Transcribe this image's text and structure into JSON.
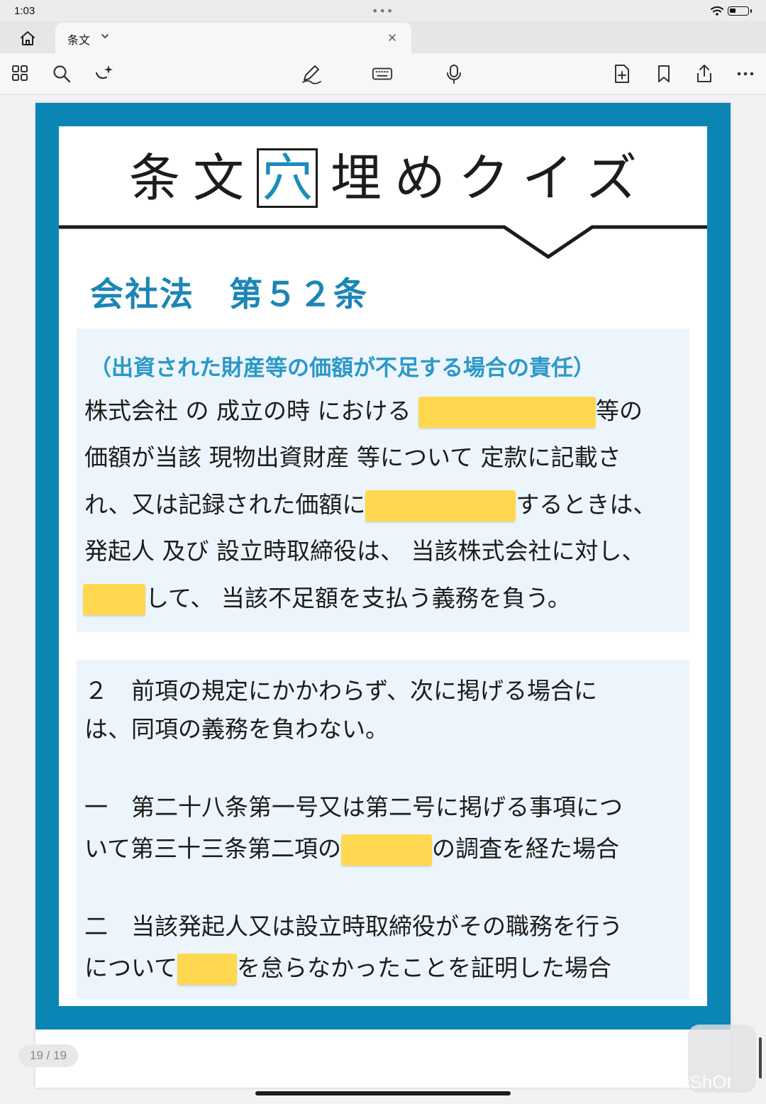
{
  "status_bar": {
    "time": "1:03",
    "dots": "•••"
  },
  "tab": {
    "title": "条文"
  },
  "quiz": {
    "title_chars": [
      "条",
      "文",
      "穴",
      "埋",
      "め",
      "ク",
      "イ",
      "ズ"
    ],
    "law_title": "会社法　第５２条",
    "section1": {
      "heading": "（出資された財産等の価額が不足する場合の責任）",
      "l1a": "株式会社 の 成立の時 における ",
      "l1b": "等の",
      "l2": "価額が当該 現物出資財産 等について 定款に記載さ",
      "l3a": "れ、又は記録された価額に",
      "l3b": "するときは、",
      "l4": "発起人 及び 設立時取締役は、 当該株式会社に対し、",
      "l5b": "して、 当該不足額を支払う義務を負う。"
    },
    "section2": {
      "l1": " ２　前項の規定にかかわらず、次に掲げる場合に",
      "l2": "は、同項の義務を負わない。",
      "l3": "一　第二十八条第一号又は第二号に掲げる事項につ",
      "l4a": "いて第三十三条第二項の",
      "l4b": "の調査を経た場合",
      "l5": "二　当該発起人又は設立時取締役がその職務を行う",
      "l6a": "について",
      "l6b": "を怠らなかったことを証明した場合"
    }
  },
  "page_indicator": "19 / 19",
  "watermark": "nShOt",
  "colors": {
    "frame": "#0b85b3",
    "accent": "#1b86b5",
    "blank": "#ffd850",
    "panel": "#ecf5fc"
  },
  "toolbar_icons": [
    "grid-icon",
    "search-icon",
    "sparkle-icon",
    "pen-icon",
    "keyboard-icon",
    "microphone-icon",
    "add-page-icon",
    "bookmark-icon",
    "share-icon",
    "more-icon"
  ]
}
